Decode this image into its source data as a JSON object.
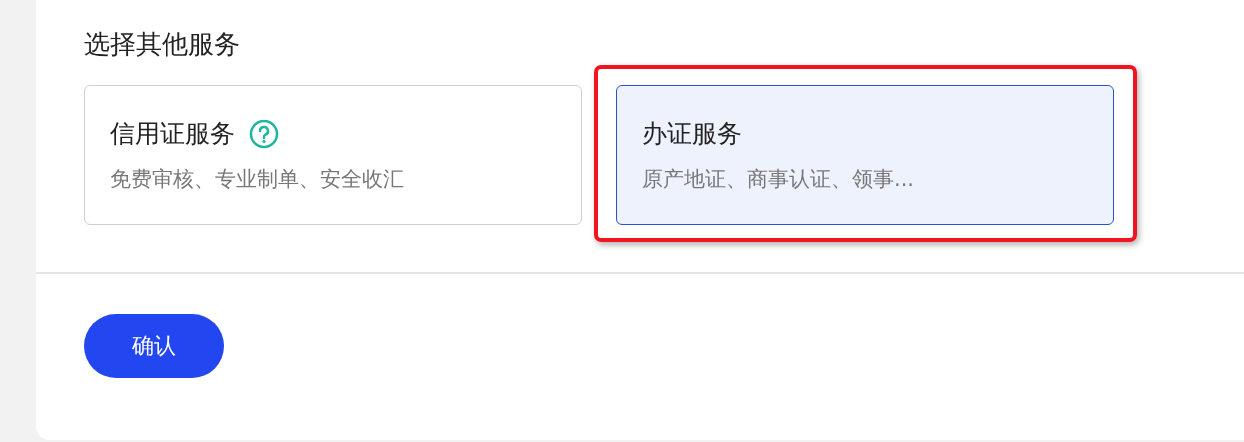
{
  "section_title": "选择其他服务",
  "services": [
    {
      "title": "信用证服务",
      "description": "免费审核、专业制单、安全收汇",
      "help": true,
      "selected": false,
      "highlighted": false
    },
    {
      "title": "办证服务",
      "description": "原产地证、商事认证、领事...",
      "help": false,
      "selected": true,
      "highlighted": true
    }
  ],
  "confirm_button": "确认"
}
